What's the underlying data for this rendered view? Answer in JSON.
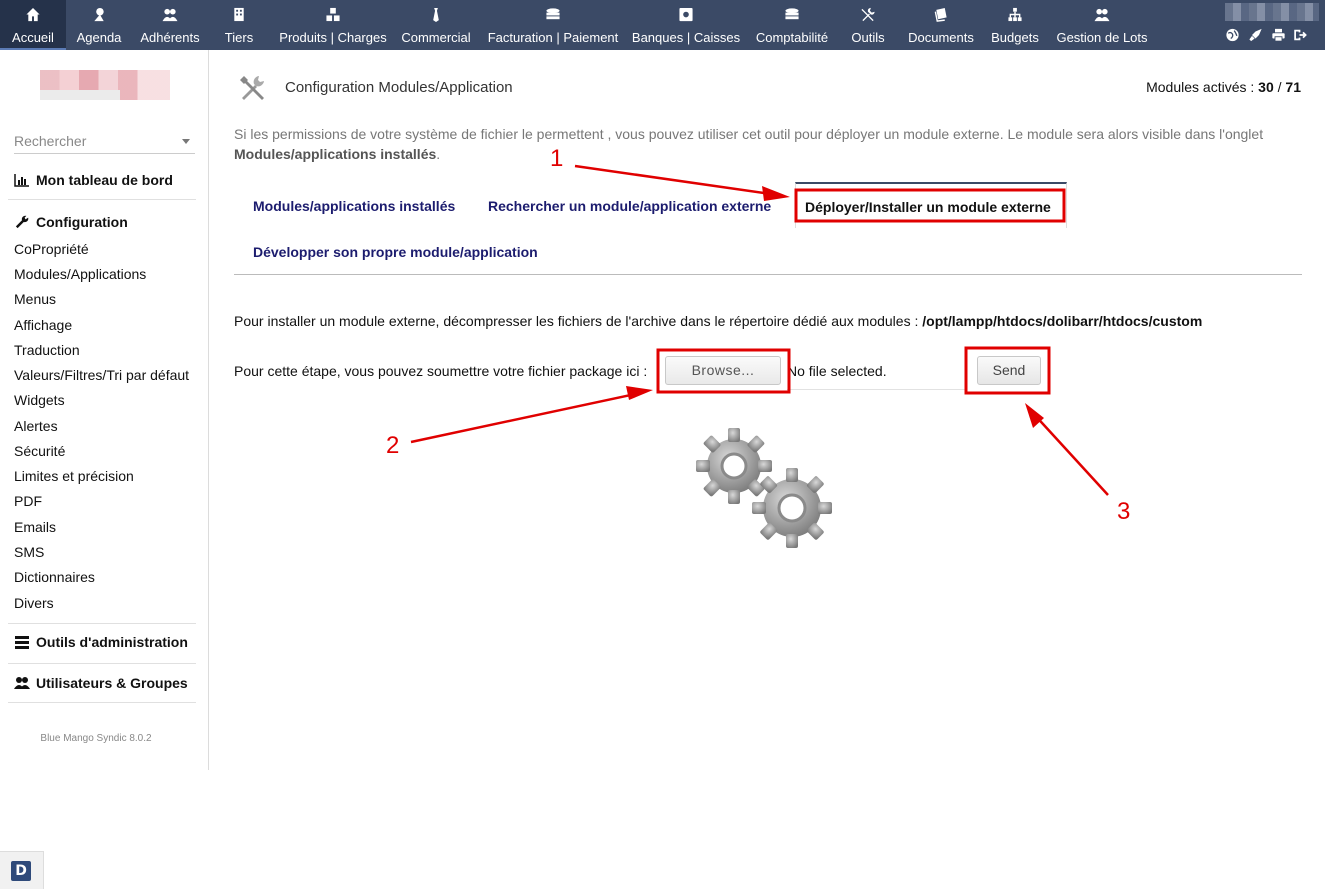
{
  "topbar": {
    "items": [
      {
        "label": "Accueil",
        "icon": "home-icon",
        "active": true
      },
      {
        "label": "Agenda",
        "icon": "agenda-icon"
      },
      {
        "label": "Adhérents",
        "icon": "members-icon"
      },
      {
        "label": "Tiers",
        "icon": "building-icon"
      },
      {
        "label": "Produits | Charges",
        "icon": "products-icon"
      },
      {
        "label": "Commercial",
        "icon": "commercial-icon"
      },
      {
        "label": "Facturation | Paiement",
        "icon": "billing-icon"
      },
      {
        "label": "Banques | Caisses",
        "icon": "bank-icon"
      },
      {
        "label": "Comptabilité",
        "icon": "accounting-icon"
      },
      {
        "label": "Outils",
        "icon": "tools-icon"
      },
      {
        "label": "Documents",
        "icon": "documents-icon"
      },
      {
        "label": "Budgets",
        "icon": "budgets-icon"
      },
      {
        "label": "Gestion de Lots",
        "icon": "lots-icon"
      }
    ],
    "right_icons": [
      "globe-icon",
      "rocket-icon",
      "print-icon",
      "logout-icon"
    ]
  },
  "sidebar": {
    "search_placeholder": "Rechercher",
    "dashboard": "Mon tableau de bord",
    "configuration": "Configuration",
    "config_items": [
      "CoPropriété",
      "Modules/Applications",
      "Menus",
      "Affichage",
      "Traduction",
      "Valeurs/Filtres/Tri par défaut",
      "Widgets",
      "Alertes",
      "Sécurité",
      "Limites et précision",
      "PDF",
      "Emails",
      "SMS",
      "Dictionnaires",
      "Divers"
    ],
    "admin_tools": "Outils d'administration",
    "users_groups": "Utilisateurs & Groupes",
    "version": "Blue Mango Syndic 8.0.2"
  },
  "main": {
    "title": "Configuration Modules/Application",
    "modules_label": "Modules activés :",
    "modules_active": "30",
    "modules_sep": "/",
    "modules_total": "71",
    "intro": "Si les permissions de votre système de fichier le permettent , vous pouvez utiliser cet outil pour déployer un module externe. Le module sera alors visible dans l'onglet",
    "intro_bold": "Modules/applications installés",
    "intro_end": ".",
    "tabs": [
      {
        "label": "Modules/applications installés"
      },
      {
        "label": "Rechercher un module/application externe"
      },
      {
        "label": "Déployer/Installer un module externe",
        "active": true
      },
      {
        "label": "Développer son propre module/application"
      }
    ],
    "install_text": "Pour installer un module externe, décompresser les fichiers de l'archive dans le répertoire dédié aux modules :",
    "install_path": "/opt/lampp/htdocs/dolibarr/htdocs/custom",
    "upload_label": "Pour cette étape, vous pouvez soumettre votre fichier package ici :",
    "browse_label": "Browse...",
    "file_status": "No file selected.",
    "send_label": "Send"
  },
  "annotations": {
    "numbers": [
      "1",
      "2",
      "3"
    ],
    "color": "#e00000"
  },
  "colors": {
    "topbar": "#3b4a66",
    "tab_text": "#1c1c6e"
  }
}
